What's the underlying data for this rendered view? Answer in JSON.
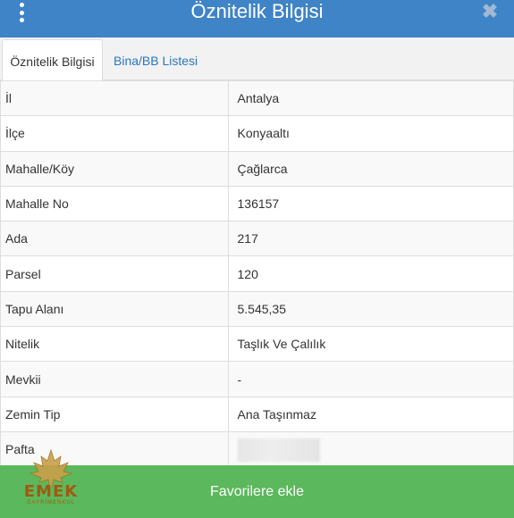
{
  "header": {
    "title": "Öznitelik Bilgisi",
    "close_symbol": "✖"
  },
  "tabs": [
    {
      "label": "Öznitelik Bilgisi",
      "active": true
    },
    {
      "label": "Bina/BB Listesi",
      "active": false
    }
  ],
  "rows": [
    {
      "label": "İl",
      "value": "Antalya"
    },
    {
      "label": "İlçe",
      "value": "Konyaaltı"
    },
    {
      "label": "Mahalle/Köy",
      "value": "Çağlarca"
    },
    {
      "label": "Mahalle No",
      "value": "136157"
    },
    {
      "label": "Ada",
      "value": "217"
    },
    {
      "label": "Parsel",
      "value": "120"
    },
    {
      "label": "Tapu Alanı",
      "value": "5.545,35"
    },
    {
      "label": "Nitelik",
      "value": "Taşlık Ve Çalılık"
    },
    {
      "label": "Mevkii",
      "value": "-"
    },
    {
      "label": "Zemin Tip",
      "value": "Ana Taşınmaz"
    },
    {
      "label": "Pafta",
      "value": ""
    }
  ],
  "favorite_button": {
    "label": "Favorilere ekle"
  },
  "logo": {
    "name": "EMEK",
    "subtitle": "GAYRİMENKUL"
  },
  "colors": {
    "header_bg": "#3f84c6",
    "button_bg": "#5cb85c",
    "link": "#2a76be"
  },
  "icons": {
    "menu": "kebab-menu-icon",
    "close": "close-icon",
    "logo": "maple-leaf-icon"
  }
}
